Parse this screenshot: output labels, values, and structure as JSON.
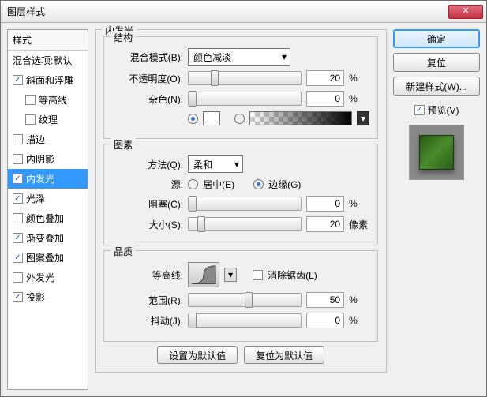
{
  "dialog": {
    "title": "图层样式"
  },
  "styles": {
    "header": "样式",
    "blend_options": "混合选项:默认",
    "items": [
      {
        "label": "斜面和浮雕",
        "checked": true
      },
      {
        "label": "等高线",
        "checked": false,
        "sub": true
      },
      {
        "label": "纹理",
        "checked": false,
        "sub": true
      },
      {
        "label": "描边",
        "checked": false
      },
      {
        "label": "内阴影",
        "checked": false
      },
      {
        "label": "内发光",
        "checked": true,
        "selected": true
      },
      {
        "label": "光泽",
        "checked": true
      },
      {
        "label": "颜色叠加",
        "checked": false
      },
      {
        "label": "渐变叠加",
        "checked": true
      },
      {
        "label": "图案叠加",
        "checked": true
      },
      {
        "label": "外发光",
        "checked": false
      },
      {
        "label": "投影",
        "checked": true
      }
    ]
  },
  "panel": {
    "title": "内发光",
    "structure": {
      "legend": "结构",
      "blend_mode_label": "混合模式(B):",
      "blend_mode_value": "颜色减淡",
      "opacity_label": "不透明度(O):",
      "opacity_value": "20",
      "opacity_unit": "%",
      "noise_label": "杂色(N):",
      "noise_value": "0",
      "noise_unit": "%"
    },
    "elements": {
      "legend": "图素",
      "technique_label": "方法(Q):",
      "technique_value": "柔和",
      "source_label": "源:",
      "source_center": "居中(E)",
      "source_edge": "边缘(G)",
      "choke_label": "阻塞(C):",
      "choke_value": "0",
      "choke_unit": "%",
      "size_label": "大小(S):",
      "size_value": "20",
      "size_unit": "像素"
    },
    "quality": {
      "legend": "品质",
      "contour_label": "等高线:",
      "antialias": "消除锯齿(L)",
      "range_label": "范围(R):",
      "range_value": "50",
      "range_unit": "%",
      "jitter_label": "抖动(J):",
      "jitter_value": "0",
      "jitter_unit": "%"
    },
    "set_default": "设置为默认值",
    "reset_default": "复位为默认值"
  },
  "actions": {
    "ok": "确定",
    "cancel": "复位",
    "new_style": "新建样式(W)...",
    "preview": "预览(V)"
  }
}
